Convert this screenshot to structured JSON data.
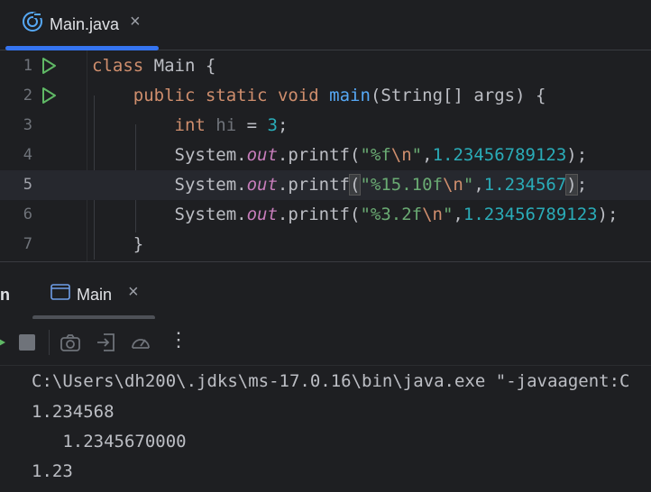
{
  "editor_tab": {
    "label": "Main.java",
    "close": "×"
  },
  "code_lines": [
    {
      "num": "1",
      "run": true
    },
    {
      "num": "2",
      "run": true
    },
    {
      "num": "3"
    },
    {
      "num": "4"
    },
    {
      "num": "5",
      "current": true
    },
    {
      "num": "6"
    },
    {
      "num": "7"
    }
  ],
  "code": {
    "l1": {
      "kw": "class",
      "name": "Main",
      "brace": "{"
    },
    "l2": {
      "kw1": "public",
      "kw2": "static",
      "kw3": "void",
      "fn": "main",
      "params": "(String[] args) {"
    },
    "l3": {
      "kw": "int",
      "var": "hi",
      "eq": " = ",
      "num": "3",
      "semi": ";"
    },
    "l4": {
      "pre": "System.",
      "fld": "out",
      "call": ".printf(",
      "str": "\"%f",
      "esc": "\\n",
      "strend": "\"",
      "comma": ",",
      "num": "1.23456789123",
      "end": ");"
    },
    "l5": {
      "pre": "System.",
      "fld": "out",
      "call": ".printf",
      "paren": "(",
      "str": "\"%15.10f",
      "esc": "\\n",
      "strend": "\"",
      "comma": ",",
      "num": "1.234567",
      "rparen": ")",
      "end": ";"
    },
    "l6": {
      "pre": "System.",
      "fld": "out",
      "call": ".printf(",
      "str": "\"%3.2f",
      "esc": "\\n",
      "strend": "\"",
      "comma": ",",
      "num": "1.23456789123",
      "end": ");"
    },
    "l7": {
      "brace": "}"
    }
  },
  "run_panel": {
    "title": "n",
    "tab_label": "Main",
    "close": "×"
  },
  "toolbar": {
    "more": "⋮"
  },
  "console_lines": [
    "C:\\Users\\dh200\\.jdks\\ms-17.0.16\\bin\\java.exe \"-javaagent:C",
    "1.234568",
    "   1.2345670000",
    "1.23"
  ],
  "colors": {
    "accent": "#3574f0",
    "run_green": "#5fb865",
    "keyword": "#cf8e6d",
    "function": "#56a8f5",
    "string": "#6aab73",
    "number": "#2aacb8",
    "field": "#c77dbb"
  }
}
